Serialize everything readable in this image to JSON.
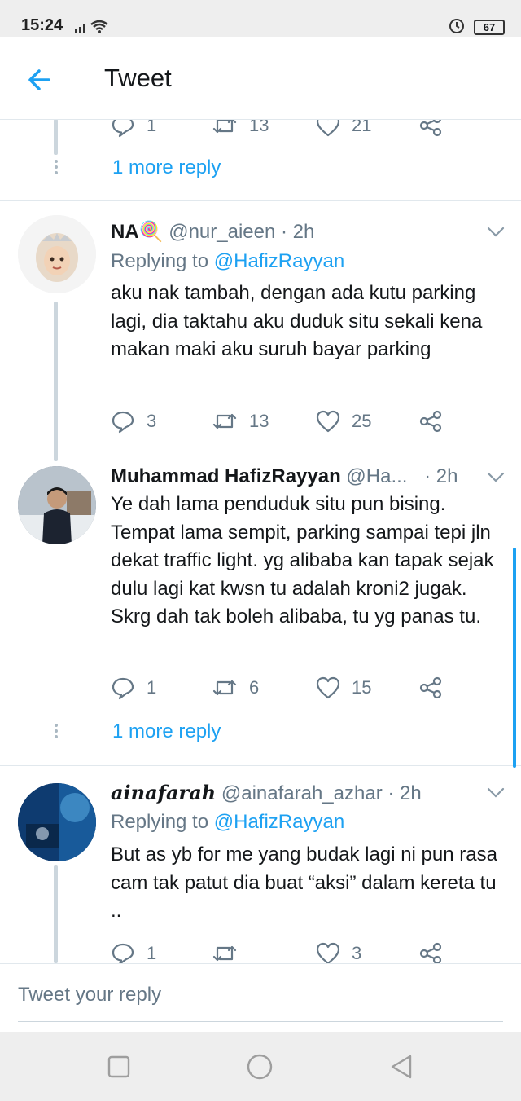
{
  "status": {
    "time": "15:24",
    "battery": "67"
  },
  "header": {
    "title": "Tweet"
  },
  "partial_tweet": {
    "replies": "1",
    "retweets": "13",
    "likes": "21",
    "more_reply": "1 more reply"
  },
  "tweets": [
    {
      "name": "NA🍭",
      "handle": "@nur_aieen",
      "time": " · 2h",
      "replying_prefix": "Replying to ",
      "replying_to": "@HafizRayyan",
      "text": "aku nak tambah, dengan ada kutu parking lagi, dia taktahu aku duduk situ sekali kena makan maki aku suruh bayar parking",
      "replies": "3",
      "retweets": "13",
      "likes": "25"
    },
    {
      "name": "Muhammad HafizRayyan",
      "handle": "@Ha...",
      "time": "· 2h",
      "text": "Ye dah lama penduduk situ pun bising. Tempat lama sempit, parking sampai tepi jln dekat traffic light. yg alibaba kan tapak sejak dulu lagi kat kwsn tu adalah kroni2 jugak. Skrg dah tak boleh alibaba, tu yg panas tu.",
      "replies": "1",
      "retweets": "6",
      "likes": "15",
      "more_reply": "1 more reply"
    },
    {
      "name": "ainafarah",
      "handle": "@ainafarah_azhar",
      "time": " · 2h",
      "replying_prefix": "Replying to ",
      "replying_to": "@HafizRayyan",
      "text": "But as yb for me yang budak lagi ni pun rasa cam tak patut dia buat “aksi” dalam kereta tu ..",
      "replies": "1",
      "retweets": "",
      "likes": "3"
    }
  ],
  "reply_bar": {
    "placeholder": "Tweet your reply"
  },
  "colors": {
    "accent": "#1da1f2",
    "muted": "#657786",
    "line": "#ccd6dd"
  }
}
